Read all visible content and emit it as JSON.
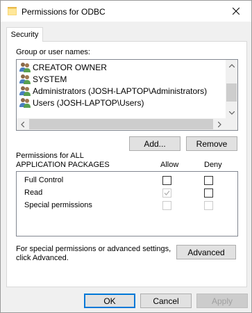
{
  "window": {
    "title": "Permissions for ODBC",
    "icon": "folder-icon"
  },
  "tabs": [
    {
      "label": "Security",
      "selected": true
    }
  ],
  "group_section": {
    "label": "Group or user names:",
    "users": [
      {
        "name": "CREATOR OWNER",
        "icon": "users-icon"
      },
      {
        "name": "SYSTEM",
        "icon": "users-icon"
      },
      {
        "name": "Administrators (JOSH-LAPTOP\\Administrators)",
        "icon": "users-icon"
      },
      {
        "name": "Users (JOSH-LAPTOP\\Users)",
        "icon": "users-icon"
      }
    ]
  },
  "buttons": {
    "add": "Add...",
    "remove": "Remove",
    "advanced": "Advanced",
    "ok": "OK",
    "cancel": "Cancel",
    "apply": "Apply"
  },
  "permissions": {
    "header_line1": "Permissions for ALL",
    "header_line2": "APPLICATION PACKAGES",
    "allow_label": "Allow",
    "deny_label": "Deny",
    "rows": [
      {
        "name": "Full Control",
        "allow": false,
        "allow_enabled": true,
        "deny": false,
        "deny_enabled": true
      },
      {
        "name": "Read",
        "allow": true,
        "allow_enabled": false,
        "deny": false,
        "deny_enabled": true
      },
      {
        "name": "Special permissions",
        "allow": false,
        "allow_enabled": false,
        "deny": false,
        "deny_enabled": false
      }
    ]
  },
  "advanced_note": {
    "line1": "For special permissions or advanced settings,",
    "line2": "click Advanced."
  },
  "colors": {
    "accent": "#0078d7",
    "window_bg": "#f0f0f0",
    "panel_bg": "#ffffff"
  }
}
